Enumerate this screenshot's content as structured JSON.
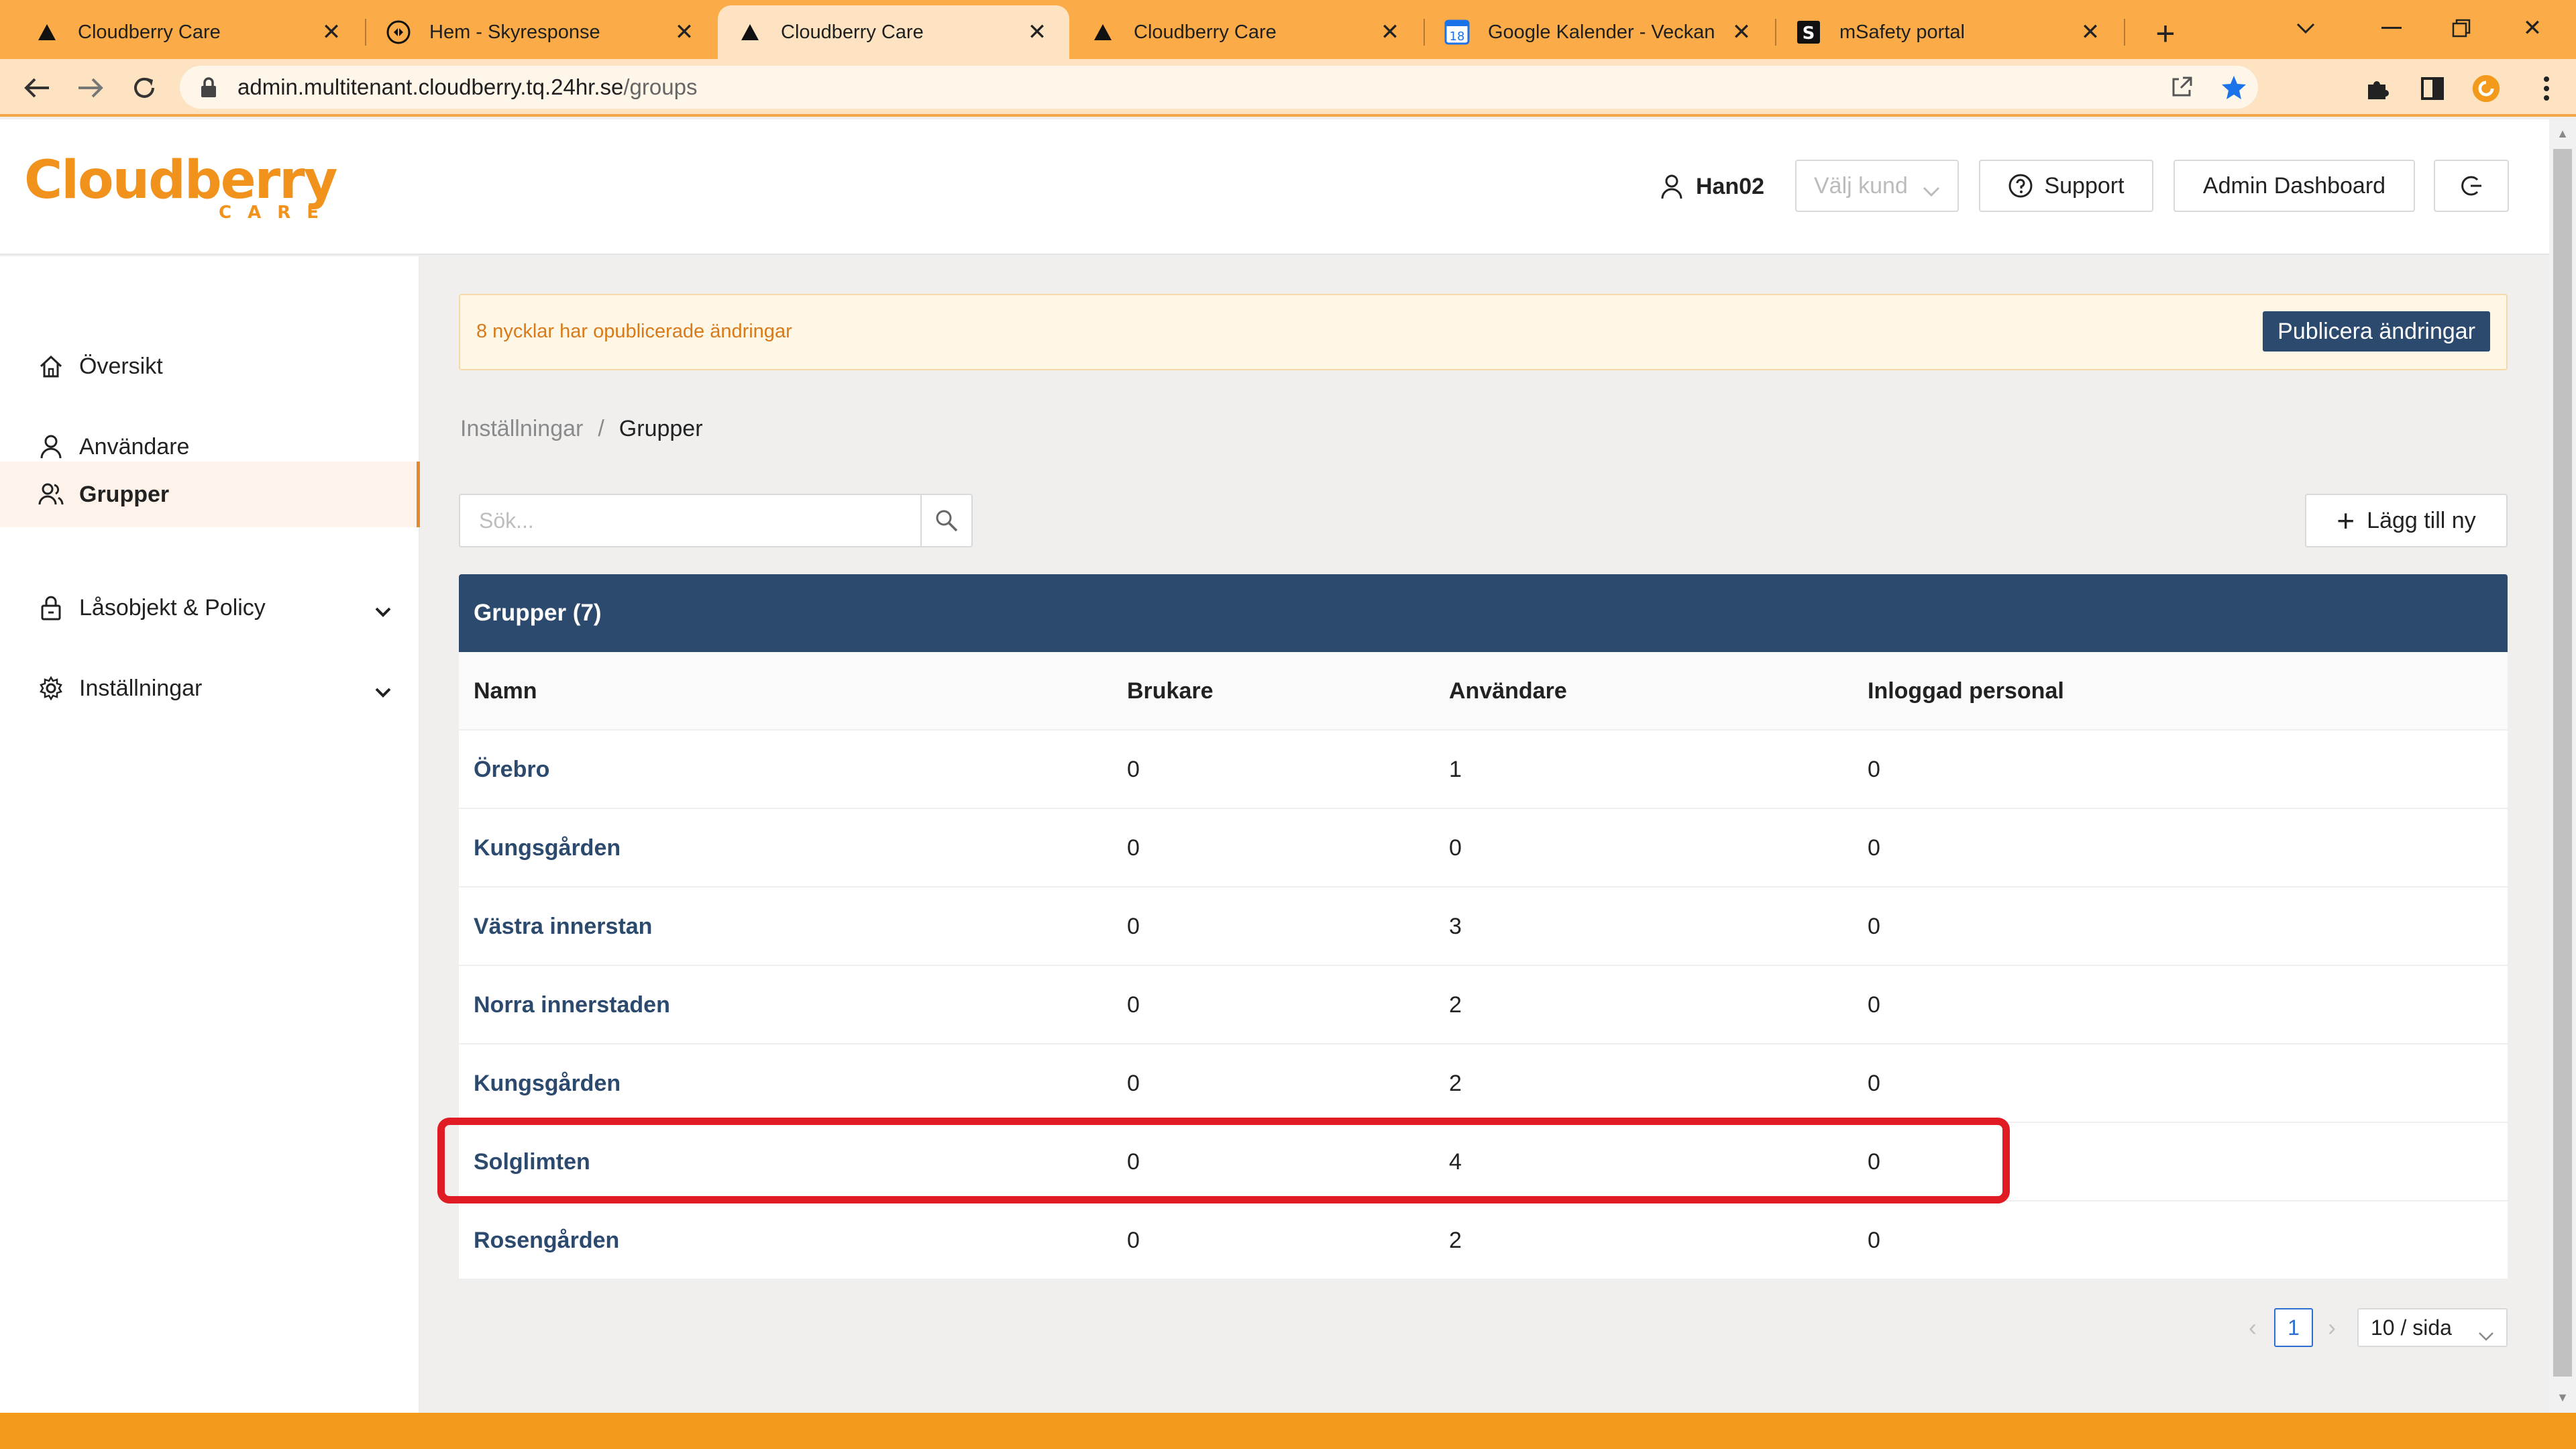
{
  "browser": {
    "tabs": [
      {
        "title": "Cloudberry Care",
        "icon": "triangle-icon"
      },
      {
        "title": "Hem - Skyresponse",
        "icon": "skyresponse-icon"
      },
      {
        "title": "Cloudberry Care",
        "icon": "triangle-icon"
      },
      {
        "title": "Cloudberry Care",
        "icon": "triangle-icon"
      },
      {
        "title": "Google Kalender - Veckan",
        "icon": "calendar-icon",
        "calendar_day": "18"
      },
      {
        "title": "mSafety portal",
        "icon": "msafety-icon",
        "letter": "S"
      }
    ],
    "url_host": "admin.multitenant.cloudberry.tq.24hr.se",
    "url_path": "/groups",
    "colors": {
      "tabbar": "#fbac48",
      "toolbar": "#fde3c1",
      "star": "#1a73e8"
    }
  },
  "header": {
    "logo_word": "Cloudberry",
    "logo_sub": "CARE",
    "username": "Han02",
    "customer_select": "Välj kund",
    "support_label": "Support",
    "admin_dashboard_label": "Admin Dashboard"
  },
  "sidebar": {
    "items": [
      {
        "label": "Översikt",
        "icon": "home-icon",
        "active": false
      },
      {
        "label": "Användare",
        "icon": "user-icon",
        "active": false
      },
      {
        "label": "Grupper",
        "icon": "group-icon",
        "active": true
      },
      {
        "label": "Låsobjekt & Policy",
        "icon": "lock-icon",
        "active": false,
        "expandable": true
      },
      {
        "label": "Inställningar",
        "icon": "gear-icon",
        "active": false,
        "expandable": true
      }
    ]
  },
  "alert": {
    "text": "8 nycklar har opublicerade ändringar",
    "publish_label": "Publicera ändringar"
  },
  "breadcrumb": {
    "parent": "Inställningar",
    "separator": "/",
    "current": "Grupper"
  },
  "search": {
    "placeholder": "Sök..."
  },
  "add_label": "Lägg till ny",
  "table": {
    "title": "Grupper (7)",
    "columns": [
      "Namn",
      "Brukare",
      "Användare",
      "Inloggad personal"
    ],
    "rows": [
      {
        "name": "Örebro",
        "brukare": "0",
        "anvandare": "1",
        "inloggad": "0"
      },
      {
        "name": "Kungsgården",
        "brukare": "0",
        "anvandare": "0",
        "inloggad": "0"
      },
      {
        "name": "Västra innerstan",
        "brukare": "0",
        "anvandare": "3",
        "inloggad": "0"
      },
      {
        "name": "Norra innerstaden",
        "brukare": "0",
        "anvandare": "2",
        "inloggad": "0"
      },
      {
        "name": "Kungsgården",
        "brukare": "0",
        "anvandare": "2",
        "inloggad": "0"
      },
      {
        "name": "Solglimten",
        "brukare": "0",
        "anvandare": "4",
        "inloggad": "0",
        "highlighted": true
      },
      {
        "name": "Rosengården",
        "brukare": "0",
        "anvandare": "2",
        "inloggad": "0"
      }
    ],
    "highlight_color": "#e11b24"
  },
  "pagination": {
    "current_page": "1",
    "page_size": "10 / sida"
  },
  "colors": {
    "brand_orange": "#f0921b",
    "navy": "#2c4a6e",
    "alert_text": "#d97a1a"
  }
}
